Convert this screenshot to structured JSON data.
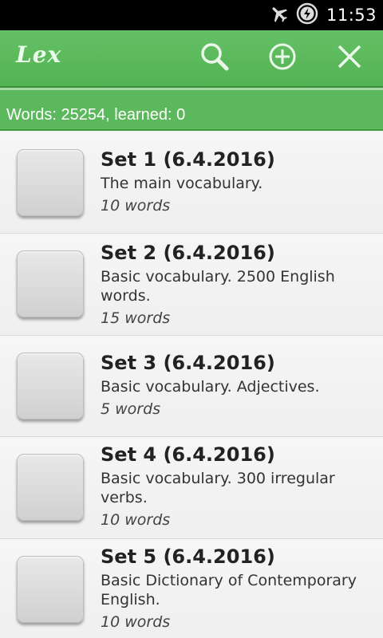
{
  "status_bar": {
    "time": "11:53",
    "icons": [
      "airplane-mode-icon",
      "battery-charging-icon"
    ]
  },
  "action_bar": {
    "app_logo": "Lex",
    "actions": [
      "search-icon",
      "add-circle-icon",
      "close-icon"
    ]
  },
  "info": {
    "summary": "Words: 25254, learned: 0"
  },
  "sets": [
    {
      "title": "Set 1 (6.4.2016)",
      "description": "The main vocabulary.",
      "count": "10 words"
    },
    {
      "title": "Set 2 (6.4.2016)",
      "description": "Basic vocabulary. 2500 English words.",
      "count": "15 words"
    },
    {
      "title": "Set 3 (6.4.2016)",
      "description": "Basic vocabulary. Adjectives.",
      "count": "5 words"
    },
    {
      "title": "Set 4 (6.4.2016)",
      "description": "Basic vocabulary. 300 irregular verbs.",
      "count": "10 words"
    },
    {
      "title": "Set 5 (6.4.2016)",
      "description": "Basic Dictionary of Contemporary English.",
      "count": "10 words"
    }
  ],
  "colors": {
    "accent": "#5cb85c",
    "status_bar": "#000000"
  }
}
